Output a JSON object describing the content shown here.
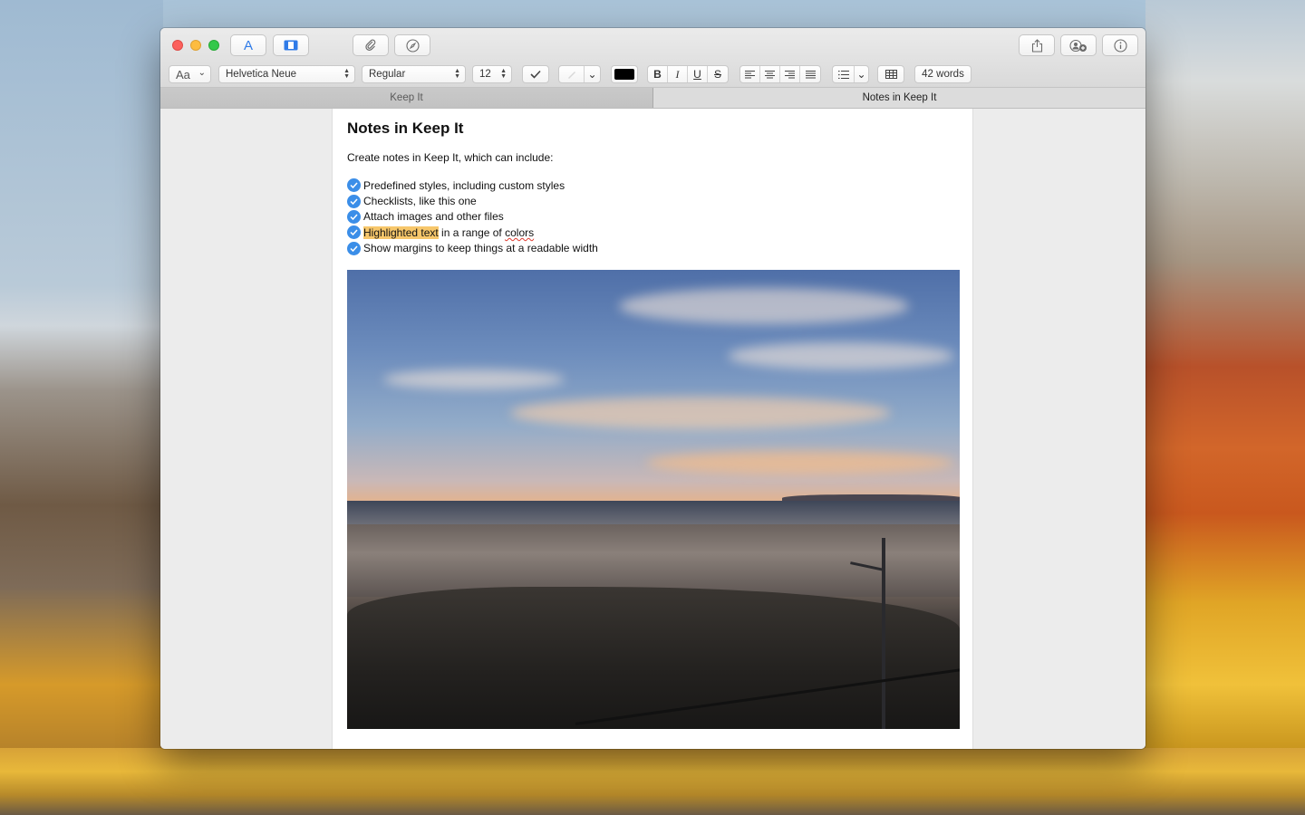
{
  "window": {
    "toolbar": {
      "font_style_label": "Aa",
      "font_family": "Helvetica Neue",
      "font_weight": "Regular",
      "font_size": "12",
      "text_color": "#000000",
      "bold_label": "B",
      "italic_label": "I",
      "underline_label": "U",
      "strike_label": "S",
      "word_count": "42 words"
    },
    "tabs": [
      {
        "label": "Keep It",
        "active": false
      },
      {
        "label": "Notes in Keep It",
        "active": true
      }
    ]
  },
  "note": {
    "title": "Notes in Keep It",
    "intro": "Create notes in Keep It, which can include:",
    "checklist": [
      {
        "text": "Predefined styles, including custom styles",
        "checked": true
      },
      {
        "text": "Checklists, like this one",
        "checked": true
      },
      {
        "text": "Attach images and other files",
        "checked": true
      },
      {
        "highlight": "Highlighted text",
        "rest_before": " in a range of ",
        "squiggle": "colors",
        "checked": true
      },
      {
        "text": "Show margins to keep things at a readable width",
        "checked": true
      }
    ],
    "highlight_color": "#f7c76b",
    "accent_color": "#3b8ee8"
  }
}
